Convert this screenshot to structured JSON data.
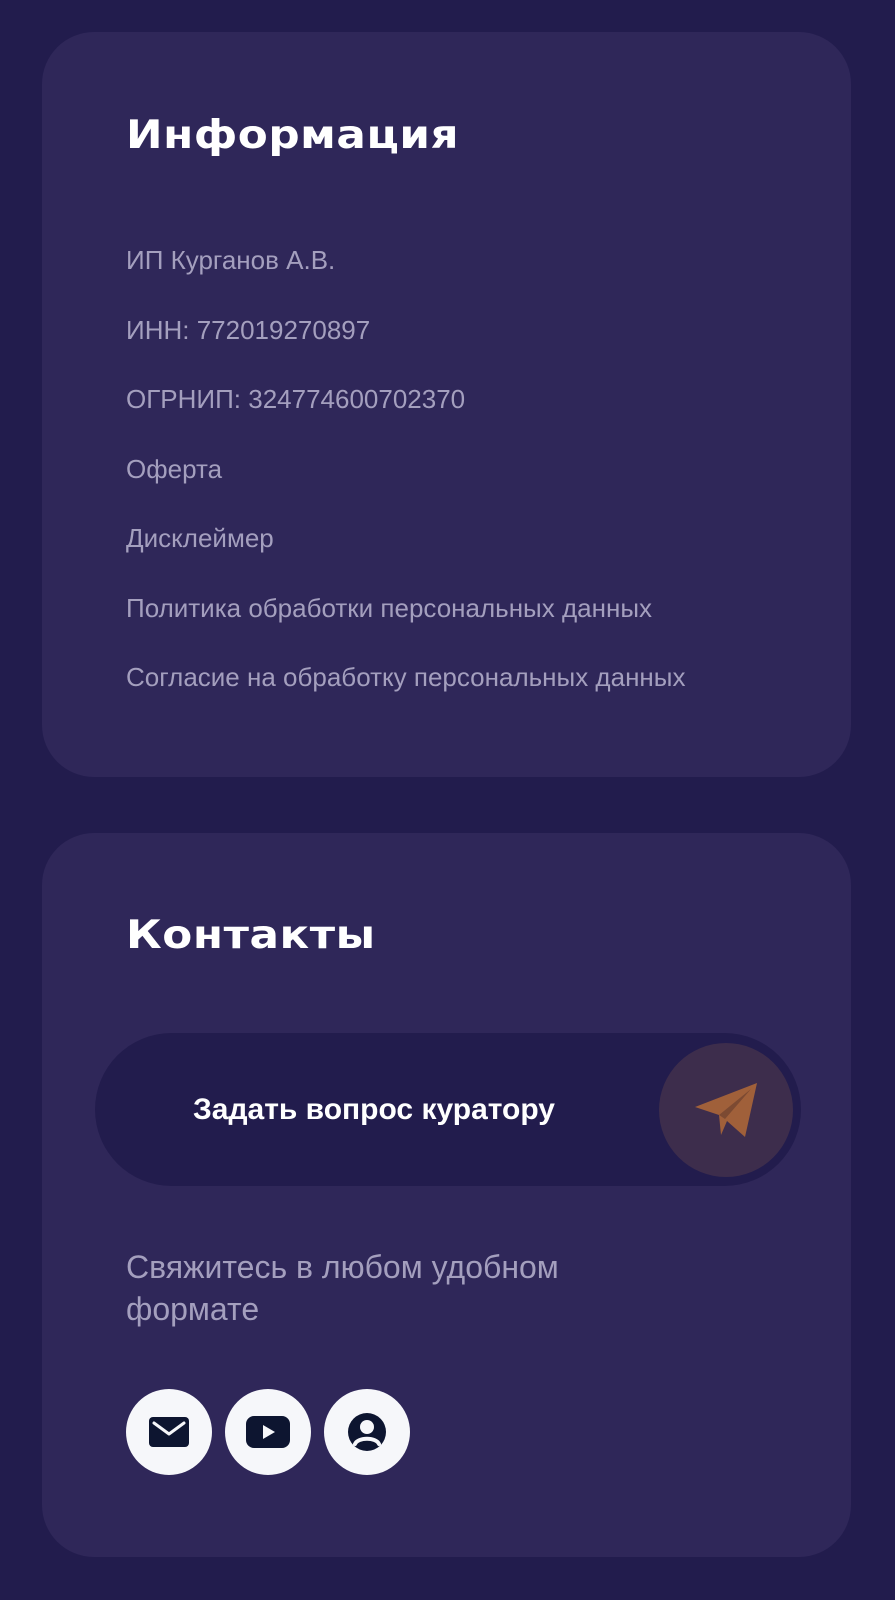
{
  "info": {
    "title": "Информация",
    "items": [
      "ИП Курганов А.В.",
      "ИНН: 772019270897",
      "ОГРНИП: 324774600702370",
      "Оферта",
      "Дисклеймер",
      "Политика обработки персональных данных",
      "Согласие на обработку персональных данных"
    ]
  },
  "contacts": {
    "title": "Контакты",
    "ask_button_label": "Задать вопрос куратору",
    "ask_button_icon": "telegram-icon",
    "contact_text": "Свяжитесь в любом удобном формате",
    "social_icons": [
      "mail-icon",
      "youtube-icon",
      "profile-icon"
    ]
  },
  "colors": {
    "page_background": "#221c4d",
    "card_background": "#2f2759",
    "muted_text": "#a49fbe",
    "accent_orange": "#a0603a"
  }
}
